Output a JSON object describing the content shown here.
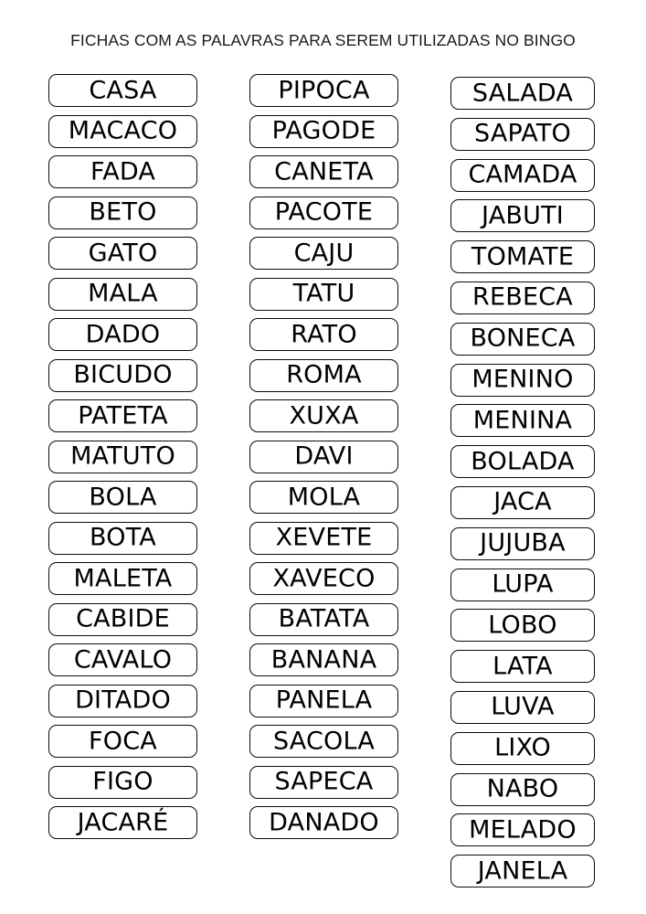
{
  "document": {
    "title": "FICHAS COM AS PALAVRAS PARA SEREM UTILIZADAS NO BINGO",
    "language": "pt-BR",
    "background_color": "#ffffff",
    "text_color": "#000000",
    "chip_border_color": "#0a0a0a"
  },
  "columns": [
    {
      "id": "column-1",
      "words": [
        "CASA",
        "MACACO",
        "FADA",
        "BETO",
        "GATO",
        "MALA",
        "DADO",
        "BICUDO",
        "PATETA",
        "MATUTO",
        "BOLA",
        "BOTA",
        "MALETA",
        "CABIDE",
        "CAVALO",
        "DITADO",
        "FOCA",
        "FIGO",
        "JACARÉ"
      ]
    },
    {
      "id": "column-2",
      "words": [
        "PIPOCA",
        "PAGODE",
        "CANETA",
        "PACOTE",
        "CAJU",
        "TATU",
        "RATO",
        "ROMA",
        "XUXA",
        "DAVI",
        "MOLA",
        "XEVETE",
        "XAVECO",
        "BATATA",
        "BANANA",
        "PANELA",
        "SACOLA",
        "SAPECA",
        "DANADO"
      ]
    },
    {
      "id": "column-3",
      "words": [
        "SALADA",
        "SAPATO",
        "CAMADA",
        "JABUTI",
        "TOMATE",
        "REBECA",
        "BONECA",
        "MENINO",
        "MENINA",
        "BOLADA",
        "JACA",
        "JUJUBA",
        "LUPA",
        "LOBO",
        "LATA",
        "LUVA",
        "LIXO",
        "NABO",
        "MELADO",
        "JANELA"
      ]
    }
  ]
}
